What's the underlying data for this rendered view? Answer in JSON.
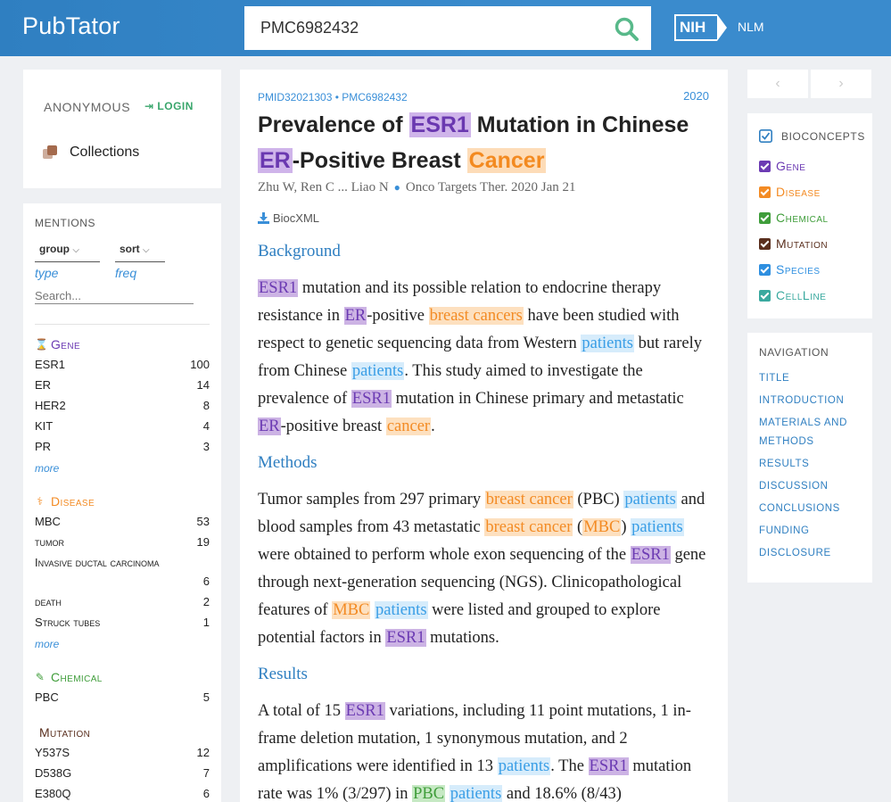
{
  "header": {
    "logo": "PubTator",
    "search_value": "PMC6982432",
    "nih_mark": "NIH",
    "nlm": "NLM"
  },
  "user": {
    "anonymous": "ANONYMOUS",
    "login": "LOGIN",
    "collections": "Collections"
  },
  "mentions": {
    "title": "MENTIONS",
    "group_label": "group",
    "group_value": "type",
    "sort_label": "sort",
    "sort_value": "freq",
    "search_placeholder": "Search...",
    "more": "more",
    "categories": [
      {
        "name": "Gene",
        "color": "#6c3bb3",
        "icon": "dna-icon",
        "items": [
          {
            "label": "ESR1",
            "count": "100"
          },
          {
            "label": "ER",
            "count": "14"
          },
          {
            "label": "HER2",
            "count": "8"
          },
          {
            "label": "KIT",
            "count": "4"
          },
          {
            "label": "PR",
            "count": "3"
          }
        ]
      },
      {
        "name": "Disease",
        "color": "#f38b24",
        "icon": "stethoscope-icon",
        "items": [
          {
            "label": "MBC",
            "count": "53"
          },
          {
            "label": "tumor",
            "count": "19"
          },
          {
            "label": "Invasive ductal carcinoma",
            "count": "6"
          },
          {
            "label": "death",
            "count": "2"
          },
          {
            "label": "Struck tubes",
            "count": "1"
          }
        ]
      },
      {
        "name": "Chemical",
        "color": "#3f9d3a",
        "icon": "eyedropper-icon",
        "items": [
          {
            "label": "PBC",
            "count": "5"
          }
        ]
      },
      {
        "name": "Mutation",
        "color": "#5a2f1e",
        "icon": "",
        "items": [
          {
            "label": "Y537S",
            "count": "12"
          },
          {
            "label": "D538G",
            "count": "7"
          },
          {
            "label": "E380Q",
            "count": "6"
          }
        ]
      }
    ]
  },
  "article": {
    "ids": "PMID32021303 • PMC6982432",
    "year": "2020",
    "authors": "Zhu W, Ren C ... Liao N",
    "journal": "Onco Targets Ther. 2020 Jan 21",
    "biocxml": "BiocXML",
    "sections": {
      "background": "Background",
      "methods": "Methods",
      "results": "Results"
    },
    "title_tokens": [
      {
        "t": "Prevalence of "
      },
      {
        "t": "ESR1",
        "c": "gene"
      },
      {
        "t": " Mutation in Chinese "
      },
      {
        "t": "ER",
        "c": "gene"
      },
      {
        "t": "-Positive Breast "
      },
      {
        "t": "Cancer",
        "c": "disease"
      }
    ],
    "background_tokens": [
      {
        "t": "ESR1",
        "c": "gene"
      },
      {
        "t": " mutation and its possible relation to endocrine therapy resistance in "
      },
      {
        "t": "ER",
        "c": "gene"
      },
      {
        "t": "-positive "
      },
      {
        "t": "breast cancers",
        "c": "disease"
      },
      {
        "t": " have been studied with respect to genetic sequencing data from Western "
      },
      {
        "t": "patients",
        "c": "species"
      },
      {
        "t": " but rarely from Chinese "
      },
      {
        "t": "patients",
        "c": "species"
      },
      {
        "t": ". This study aimed to investigate the prevalence of "
      },
      {
        "t": "ESR1",
        "c": "gene"
      },
      {
        "t": " mutation in Chinese primary and metastatic "
      },
      {
        "t": "ER",
        "c": "gene"
      },
      {
        "t": "-positive breast "
      },
      {
        "t": "cancer",
        "c": "disease"
      },
      {
        "t": "."
      }
    ],
    "methods_tokens": [
      {
        "t": "Tumor samples from 297 primary "
      },
      {
        "t": "breast cancer",
        "c": "disease"
      },
      {
        "t": " (PBC) "
      },
      {
        "t": "patients",
        "c": "species"
      },
      {
        "t": " and blood samples from 43 metastatic "
      },
      {
        "t": "breast cancer",
        "c": "disease"
      },
      {
        "t": " ("
      },
      {
        "t": "MBC",
        "c": "disease"
      },
      {
        "t": ") "
      },
      {
        "t": "patients",
        "c": "species"
      },
      {
        "t": " were obtained to perform whole exon sequencing of the "
      },
      {
        "t": "ESR1",
        "c": "gene"
      },
      {
        "t": " gene through next-generation sequencing (NGS). Clinicopathological features of "
      },
      {
        "t": "MBC",
        "c": "disease"
      },
      {
        "t": " "
      },
      {
        "t": "patients",
        "c": "species"
      },
      {
        "t": " were listed and grouped to explore potential factors in "
      },
      {
        "t": "ESR1",
        "c": "gene"
      },
      {
        "t": " mutations."
      }
    ],
    "results_tokens": [
      {
        "t": "A total of 15 "
      },
      {
        "t": "ESR1",
        "c": "gene"
      },
      {
        "t": " variations, including 11 point mutations, 1 in-frame deletion mutation, 1 synonymous mutation, and 2 amplifications were identified in 13 "
      },
      {
        "t": "patients",
        "c": "species"
      },
      {
        "t": ". The "
      },
      {
        "t": "ESR1",
        "c": "gene"
      },
      {
        "t": " mutation rate was 1% (3/297) in "
      },
      {
        "t": "PBC",
        "c": "chem"
      },
      {
        "t": " "
      },
      {
        "t": "patients",
        "c": "species"
      },
      {
        "t": " and 18.6% (8/43)"
      }
    ]
  },
  "bioconcepts": {
    "title": "BIOCONCEPTS",
    "items": [
      {
        "label": "Gene",
        "color": "#6c3bb3"
      },
      {
        "label": "Disease",
        "color": "#f38b24"
      },
      {
        "label": "Chemical",
        "color": "#3f9d3a"
      },
      {
        "label": "Mutation",
        "color": "#5a2f1e"
      },
      {
        "label": "Species",
        "color": "#2e8fe0"
      },
      {
        "label": "CellLine",
        "color": "#3aa99f"
      }
    ]
  },
  "navigation": {
    "title": "NAVIGATION",
    "items": [
      "Title",
      "Introduction",
      "Materials and Methods",
      "Results",
      "Discussion",
      "Conclusions",
      "Funding",
      "Disclosure"
    ]
  },
  "pager": {
    "prev": "‹",
    "next": "›"
  },
  "colors": {
    "header": "#3a8bcd",
    "accent_green": "#3aa66c",
    "link": "#3a8fd8"
  }
}
